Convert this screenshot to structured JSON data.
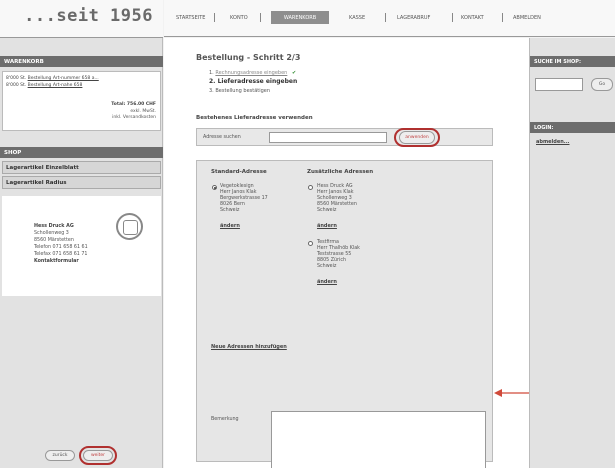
{
  "brand": {
    "logo": "...seit 1956"
  },
  "nav": {
    "items": [
      "STARTSEITE",
      "KONTO",
      "WARENKORB",
      "KASSE",
      "LAGERABRUF",
      "KONTAKT",
      "ABMELDEN"
    ],
    "active": "WARENKORB"
  },
  "sidebar": {
    "basket_title": "WARENKORB",
    "basket_items": [
      {
        "qty": "8'000 St.",
        "name": "Bestellung Art-nummer 658 a..."
      },
      {
        "qty": "8'000 St.",
        "name": "Bestellung Art-nahe 658"
      }
    ],
    "total": "Total: 756.00 CHF",
    "total_note1": "exkl. MwSt.",
    "total_note2": "inkl. Versandkosten",
    "shop_title": "SHOP",
    "shop_items": [
      "Lagerartikel Einzelblatt",
      "Lagerartikel Radius"
    ],
    "company": {
      "name": "Hess Druck AG",
      "street": "Schollenweg 3",
      "city": "8560 Märstetten",
      "phone": "Telefon 071 658 61 61",
      "fax": "Telefax 071 658 61 71",
      "contact": "Kontaktformular"
    }
  },
  "main": {
    "title": "Bestellung - Schritt 2/3",
    "steps": [
      {
        "num": "1.",
        "label": "Rechnungsadresse eingeben",
        "done": true
      },
      {
        "num": "2.",
        "label": "Lieferadresse eingeben"
      },
      {
        "num": "3.",
        "label": "Bestellung bestätigen"
      }
    ],
    "existing_title": "Bestehenes Lieferadresse verwenden",
    "search_label": "Adresse suchen",
    "search_button": "anwenden",
    "default_head": "Standard-Adresse",
    "additional_head": "Zusätzliche Adressen",
    "default_address": [
      "Vegetoklesign",
      "Herr Janos Klak",
      "Bergwerkstrasse 17",
      "8026 Bern",
      "Schweiz"
    ],
    "additional_addresses": [
      [
        "Hess Druck AG",
        "Herr Janos Klak",
        "Schollenweg 3",
        "8560 Märstetten",
        "Schweiz"
      ],
      [
        "Testfirma",
        "Herr Thalhöb Klak",
        "Teststrasse 55",
        "8805 Zürich",
        "Schweiz"
      ]
    ],
    "edit_label": "ändern",
    "new_address": "Neue Adressen hinzufügen",
    "remark_label": "Bemerkung",
    "back_button": "zurück",
    "next_button": "weiter"
  },
  "right": {
    "search_title": "SUCHE IM SHOP:",
    "search_button": "Go",
    "login_title": "LOGIN:",
    "login_link": "abmelden..."
  },
  "colors": {
    "accent_red": "#b0302f",
    "header_gray": "#6d6d6d",
    "check_green": "#2e8b2e"
  }
}
